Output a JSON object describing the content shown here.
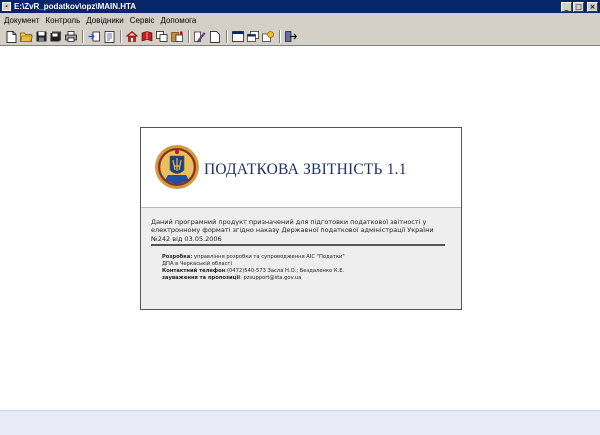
{
  "window": {
    "title": "E:\\ZvR_podatkov\\opz\\MAIN.HTA",
    "minimize": "_",
    "maximize": "□",
    "close": "×"
  },
  "menu": [
    {
      "label": "Документ"
    },
    {
      "label": "Контроль"
    },
    {
      "label": "Довідники"
    },
    {
      "label": "Сервіс"
    },
    {
      "label": "Допомога"
    }
  ],
  "toolbar": {
    "icons": [
      "new-document-icon",
      "open-folder-icon",
      "save-icon",
      "save-all-icon",
      "print-icon",
      "export-icon",
      "report-icon",
      "home-icon",
      "book-icon",
      "copy-icon",
      "clipboard-icon",
      "edit-pen-icon",
      "blank-page-icon",
      "window-icon",
      "windows-icon",
      "layer-icon",
      "exit-icon"
    ]
  },
  "about": {
    "app_title": "ПОДАТКОВА ЗВІТНІСТЬ 1.1",
    "description": "Даний програмний продукт призначений для підготовки податкової звітності у електронному форматі згідно наказу Державної податкової адміністрації України №242 від 03.05.2006",
    "developer_label": "Розробка:",
    "developer_value": "управління розробки та супроводження АІС \"Податки\"",
    "developer_org": "ДПА в Черкаській області",
    "phone_label": "Контактний телефон",
    "phone_value": ":(0472)540-573 Засла Н.О.; Бездаленко К.Е.",
    "remarks_label": "зауваження та пропозиції",
    "remarks_value": ": pzsupport@sta.gov.ua"
  },
  "colors": {
    "titlebar": "#08246b",
    "chrome": "#d4d0c8",
    "title_text": "#1f2f6a",
    "panel_gray": "#eeeeee",
    "bottom_bar": "#e7ecf6"
  }
}
